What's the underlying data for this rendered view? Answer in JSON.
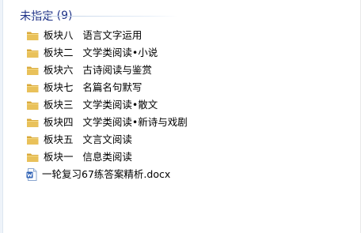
{
  "group": {
    "title": "未指定",
    "count": "(9)"
  },
  "items": [
    {
      "type": "folder",
      "icon": "folder-icon",
      "label": "板块八   语言文字运用"
    },
    {
      "type": "folder",
      "icon": "folder-icon",
      "label": "板块二   文学类阅读•小说"
    },
    {
      "type": "folder",
      "icon": "folder-icon",
      "label": "板块六   古诗阅读与鉴赏"
    },
    {
      "type": "folder",
      "icon": "folder-icon",
      "label": "板块七   名篇名句默写"
    },
    {
      "type": "folder",
      "icon": "folder-icon",
      "label": "板块三   文学类阅读•散文"
    },
    {
      "type": "folder",
      "icon": "folder-icon",
      "label": "板块四   文学类阅读•新诗与戏剧"
    },
    {
      "type": "folder",
      "icon": "folder-icon",
      "label": "板块五   文言文阅读"
    },
    {
      "type": "folder",
      "icon": "folder-icon",
      "label": "板块一   信息类阅读"
    },
    {
      "type": "file",
      "icon": "word-doc-icon",
      "label": "一轮复习67练答案精析.docx"
    }
  ],
  "colors": {
    "group_header": "#1e3287",
    "folder_body": "#e9c15a",
    "folder_back": "#d9a93a",
    "word_blue": "#2b5fb4"
  }
}
